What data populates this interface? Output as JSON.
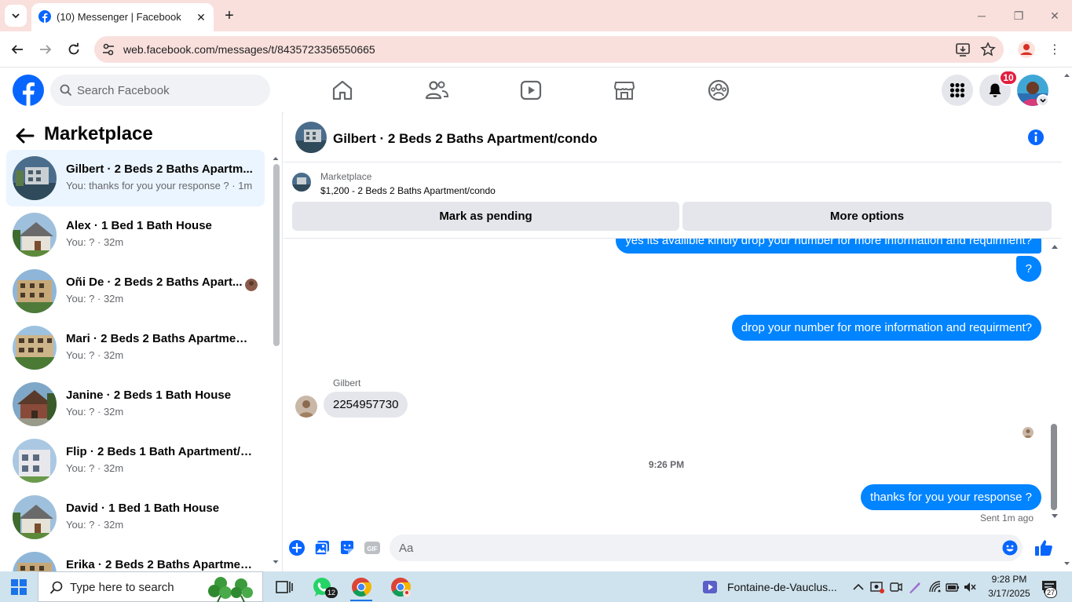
{
  "browser": {
    "tab_title": "(10) Messenger | Facebook",
    "tab_close": "✕",
    "new_tab": "+",
    "url": "web.facebook.com/messages/t/8435723356550665",
    "win_min": "─",
    "win_max": "❐",
    "win_close": "✕",
    "menu": "⋮"
  },
  "header": {
    "search_placeholder": "Search Facebook",
    "notifications_count": "10"
  },
  "left": {
    "title": "Marketplace",
    "conversations": [
      {
        "name": "Gilbert · 2 Beds 2 Baths Apartm...",
        "sub": "You: thanks for you your response ? · 1m"
      },
      {
        "name": "Alex · 1 Bed 1 Bath House",
        "sub": "You: ? · 32m"
      },
      {
        "name": "Oñi De · 2 Beds 2 Baths Apart...",
        "sub": "You: ? · 32m"
      },
      {
        "name": "Mari · 2 Beds 2 Baths Apartment...",
        "sub": "You: ? · 32m"
      },
      {
        "name": "Janine · 2 Beds 1 Bath House",
        "sub": "You: ? · 32m"
      },
      {
        "name": "Flip · 2 Beds 1 Bath Apartment/c...",
        "sub": "You: ? · 32m"
      },
      {
        "name": "David · 1 Bed 1 Bath House",
        "sub": "You: ? · 32m"
      },
      {
        "name": "Erika · 2 Beds 2 Baths Apartmen...",
        "sub": ""
      }
    ]
  },
  "chat": {
    "title": "Gilbert · 2 Beds 2 Baths Apartment/condo",
    "listing_category": "Marketplace",
    "listing_desc": "$1,200 - 2 Beds 2 Baths Apartment/condo",
    "mark_pending": "Mark as pending",
    "more_options": "More options",
    "messages": {
      "out_1": "yes its availible kindly drop your number for more information and requirment?",
      "out_2": "?",
      "out_3": "drop your number for more information and requirment?",
      "sender": "Gilbert",
      "in_1": "2254957730",
      "time": "9:26 PM",
      "out_4": "thanks for you your response ?",
      "status": "Sent 1m ago"
    },
    "composer_placeholder": "Aa"
  },
  "taskbar": {
    "search_text": "Type here to search",
    "whatsapp_badge": "12",
    "media_title": "Fontaine-de-Vauclus...",
    "time": "9:28 PM",
    "date": "3/17/2025",
    "notif_count": "27"
  },
  "colors": {
    "fb_blue": "#0866ff",
    "messenger_blue": "#0084ff",
    "chrome_tint": "#f9e0dd",
    "taskbar": "#cfe3ee"
  }
}
